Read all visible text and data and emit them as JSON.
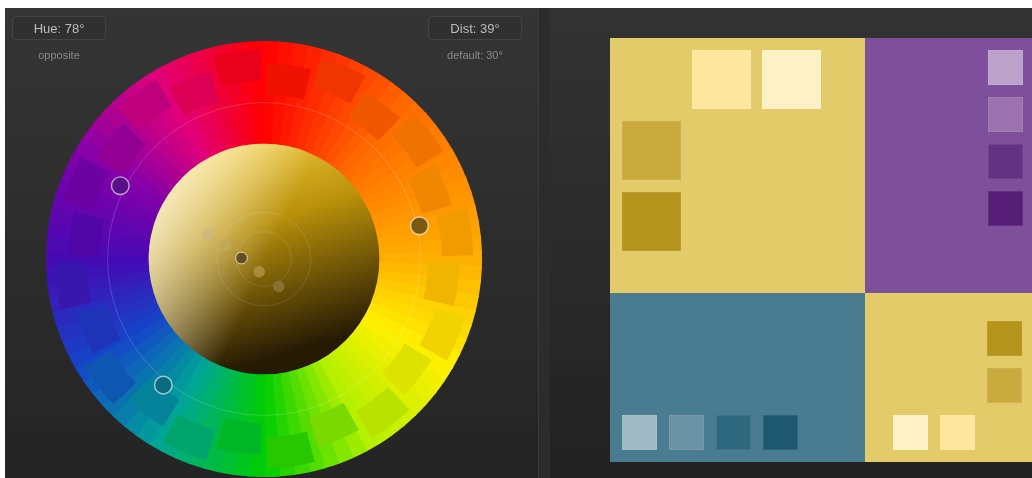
{
  "hue_box": {
    "value": "Hue: 78°",
    "caption": "opposite"
  },
  "dist_box": {
    "value": "Dist: 39°",
    "caption": "default: 30°"
  },
  "palette": [
    {
      "color": "#e3cb6a",
      "top_row": [
        {
          "color": "#fde79e"
        },
        {
          "color": "#fef1c6"
        }
      ],
      "left_column": [
        {
          "color": "#c9ab3d"
        },
        {
          "color": "#b4941d"
        }
      ]
    },
    {
      "color": "#7e509b",
      "right_column": [
        {
          "color": "#bca2cb"
        },
        {
          "color": "#9a73ae"
        },
        {
          "color": "#643283"
        },
        {
          "color": "#561e76"
        }
      ]
    },
    {
      "color": "#4a7c91",
      "bottom_row": [
        {
          "color": "#a0bac4"
        },
        {
          "color": "#6c93a3"
        },
        {
          "color": "#2e687f"
        },
        {
          "color": "#1d5870"
        }
      ]
    },
    {
      "color": "#e3cb6a",
      "right_column": [
        {
          "color": "#b4941d"
        },
        {
          "color": "#c9ab3d"
        }
      ],
      "bottom_row": [
        {
          "color": "#fef1c6"
        },
        {
          "color": "#fde79e"
        }
      ]
    }
  ]
}
